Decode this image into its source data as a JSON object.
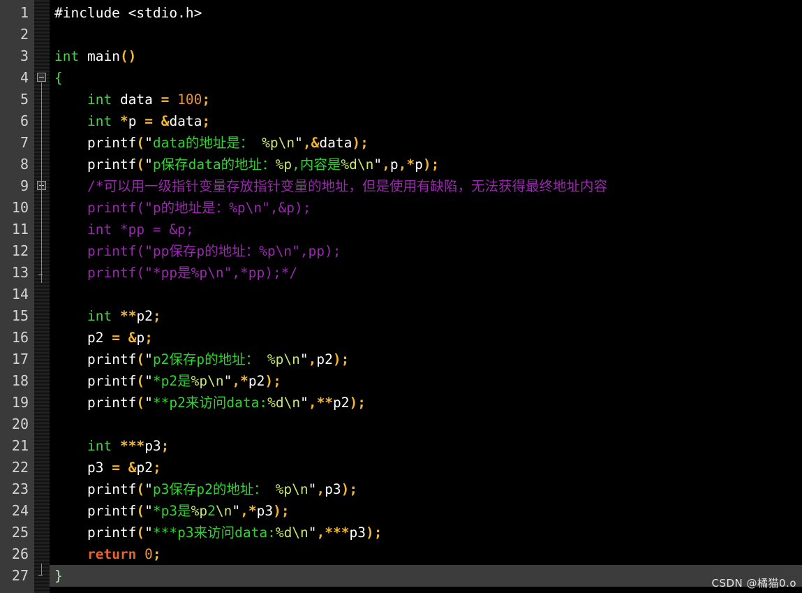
{
  "editor": {
    "theme_name": "dark-c-theme",
    "colors": {
      "background": "#000000",
      "gutter_background": "#3a3a3a",
      "gutter_text": "#d4d4d4",
      "current_line_highlight": "#3c3c3c",
      "keyword": "#44d544",
      "keyword_return": "#e8622c",
      "operator": "#f2b632",
      "number": "#e8913a",
      "string": "#2fd52f",
      "format_specifier": "#c8e86a",
      "comment": "#9c27b0",
      "plain_text": "#ffffff"
    },
    "first_line": 1,
    "last_line": 27,
    "current_line": 27,
    "fold_markers": [
      4,
      9
    ],
    "line_numbers": [
      "1",
      "2",
      "3",
      "4",
      "5",
      "6",
      "7",
      "8",
      "9",
      "10",
      "11",
      "12",
      "13",
      "14",
      "15",
      "16",
      "17",
      "18",
      "19",
      "20",
      "21",
      "22",
      "23",
      "24",
      "25",
      "26",
      "27"
    ],
    "lines": [
      {
        "n": 1,
        "indent": 0,
        "tokens": [
          {
            "t": "#include <stdio.h>",
            "c": "pre"
          }
        ]
      },
      {
        "n": 2,
        "indent": 0,
        "tokens": []
      },
      {
        "n": 3,
        "indent": 0,
        "tokens": [
          {
            "t": "int",
            "c": "kw"
          },
          {
            "t": " main",
            "c": "plain"
          },
          {
            "t": "()",
            "c": "op"
          }
        ]
      },
      {
        "n": 4,
        "indent": 0,
        "tokens": [
          {
            "t": "{",
            "c": "kw"
          }
        ]
      },
      {
        "n": 5,
        "indent": 4,
        "tokens": [
          {
            "t": "int",
            "c": "kw"
          },
          {
            "t": " data ",
            "c": "plain"
          },
          {
            "t": "=",
            "c": "op"
          },
          {
            "t": " ",
            "c": "plain"
          },
          {
            "t": "100",
            "c": "num"
          },
          {
            "t": ";",
            "c": "op"
          }
        ]
      },
      {
        "n": 6,
        "indent": 4,
        "tokens": [
          {
            "t": "int",
            "c": "kw"
          },
          {
            "t": " ",
            "c": "plain"
          },
          {
            "t": "*",
            "c": "op"
          },
          {
            "t": "p ",
            "c": "plain"
          },
          {
            "t": "=",
            "c": "op"
          },
          {
            "t": " ",
            "c": "plain"
          },
          {
            "t": "&",
            "c": "op"
          },
          {
            "t": "data",
            "c": "plain"
          },
          {
            "t": ";",
            "c": "op"
          }
        ]
      },
      {
        "n": 7,
        "indent": 4,
        "tokens": [
          {
            "t": "printf",
            "c": "plain"
          },
          {
            "t": "(",
            "c": "op"
          },
          {
            "t": "\"",
            "c": "quote"
          },
          {
            "t": "data的地址是：",
            "c": "str"
          },
          {
            "t": " %p\\n",
            "c": "fmt"
          },
          {
            "t": "\"",
            "c": "quote"
          },
          {
            "t": ",",
            "c": "op"
          },
          {
            "t": "&",
            "c": "op"
          },
          {
            "t": "data",
            "c": "plain"
          },
          {
            "t": ")",
            "c": "op"
          },
          {
            "t": ";",
            "c": "op"
          }
        ]
      },
      {
        "n": 8,
        "indent": 4,
        "tokens": [
          {
            "t": "printf",
            "c": "plain"
          },
          {
            "t": "(",
            "c": "op"
          },
          {
            "t": "\"",
            "c": "quote"
          },
          {
            "t": "p保存data的地址：",
            "c": "str"
          },
          {
            "t": "%p",
            "c": "fmt"
          },
          {
            "t": ",",
            "c": "str"
          },
          {
            "t": "内容是",
            "c": "str"
          },
          {
            "t": "%d\\n",
            "c": "fmt"
          },
          {
            "t": "\"",
            "c": "quote"
          },
          {
            "t": ",",
            "c": "op"
          },
          {
            "t": "p",
            "c": "plain"
          },
          {
            "t": ",",
            "c": "op"
          },
          {
            "t": "*",
            "c": "op"
          },
          {
            "t": "p",
            "c": "plain"
          },
          {
            "t": ")",
            "c": "op"
          },
          {
            "t": ";",
            "c": "op"
          }
        ]
      },
      {
        "n": 9,
        "indent": 4,
        "tokens": [
          {
            "t": "/*可以用一级指针变量存放指针变量的地址，但是使用有缺陷，无法获得最终地址内容",
            "c": "cmt"
          }
        ]
      },
      {
        "n": 10,
        "indent": 4,
        "tokens": [
          {
            "t": "printf(\"p的地址是：%p\\n\",&p);",
            "c": "cmt"
          }
        ]
      },
      {
        "n": 11,
        "indent": 4,
        "tokens": [
          {
            "t": "int *pp = &p;",
            "c": "cmt"
          }
        ]
      },
      {
        "n": 12,
        "indent": 4,
        "tokens": [
          {
            "t": "printf(\"pp保存p的地址：%p\\n\",pp);",
            "c": "cmt"
          }
        ]
      },
      {
        "n": 13,
        "indent": 4,
        "tokens": [
          {
            "t": "printf(\"*pp是%p\\n\",*pp);*/",
            "c": "cmt"
          }
        ]
      },
      {
        "n": 14,
        "indent": 0,
        "tokens": []
      },
      {
        "n": 15,
        "indent": 4,
        "tokens": [
          {
            "t": "int",
            "c": "kw"
          },
          {
            "t": " ",
            "c": "plain"
          },
          {
            "t": "**",
            "c": "op"
          },
          {
            "t": "p2",
            "c": "plain"
          },
          {
            "t": ";",
            "c": "op"
          }
        ]
      },
      {
        "n": 16,
        "indent": 4,
        "tokens": [
          {
            "t": "p2 ",
            "c": "plain"
          },
          {
            "t": "=",
            "c": "op"
          },
          {
            "t": " ",
            "c": "plain"
          },
          {
            "t": "&",
            "c": "op"
          },
          {
            "t": "p",
            "c": "plain"
          },
          {
            "t": ";",
            "c": "op"
          }
        ]
      },
      {
        "n": 17,
        "indent": 4,
        "tokens": [
          {
            "t": "printf",
            "c": "plain"
          },
          {
            "t": "(",
            "c": "op"
          },
          {
            "t": "\"",
            "c": "quote"
          },
          {
            "t": "p2保存p的地址：",
            "c": "str"
          },
          {
            "t": " %p\\n",
            "c": "fmt"
          },
          {
            "t": "\"",
            "c": "quote"
          },
          {
            "t": ",",
            "c": "op"
          },
          {
            "t": "p2",
            "c": "plain"
          },
          {
            "t": ")",
            "c": "op"
          },
          {
            "t": ";",
            "c": "op"
          }
        ]
      },
      {
        "n": 18,
        "indent": 4,
        "tokens": [
          {
            "t": "printf",
            "c": "plain"
          },
          {
            "t": "(",
            "c": "op"
          },
          {
            "t": "\"",
            "c": "quote"
          },
          {
            "t": "*p2是",
            "c": "str"
          },
          {
            "t": "%p\\n",
            "c": "fmt"
          },
          {
            "t": "\"",
            "c": "quote"
          },
          {
            "t": ",",
            "c": "op"
          },
          {
            "t": "*",
            "c": "op"
          },
          {
            "t": "p2",
            "c": "plain"
          },
          {
            "t": ")",
            "c": "op"
          },
          {
            "t": ";",
            "c": "op"
          }
        ]
      },
      {
        "n": 19,
        "indent": 4,
        "tokens": [
          {
            "t": "printf",
            "c": "plain"
          },
          {
            "t": "(",
            "c": "op"
          },
          {
            "t": "\"",
            "c": "quote"
          },
          {
            "t": "**p2来访问data:",
            "c": "str"
          },
          {
            "t": "%d\\n",
            "c": "fmt"
          },
          {
            "t": "\"",
            "c": "quote"
          },
          {
            "t": ",",
            "c": "op"
          },
          {
            "t": "**",
            "c": "op"
          },
          {
            "t": "p2",
            "c": "plain"
          },
          {
            "t": ")",
            "c": "op"
          },
          {
            "t": ";",
            "c": "op"
          }
        ]
      },
      {
        "n": 20,
        "indent": 0,
        "tokens": []
      },
      {
        "n": 21,
        "indent": 4,
        "tokens": [
          {
            "t": "int",
            "c": "kw"
          },
          {
            "t": " ",
            "c": "plain"
          },
          {
            "t": "***",
            "c": "op"
          },
          {
            "t": "p3",
            "c": "plain"
          },
          {
            "t": ";",
            "c": "op"
          }
        ]
      },
      {
        "n": 22,
        "indent": 4,
        "tokens": [
          {
            "t": "p3 ",
            "c": "plain"
          },
          {
            "t": "=",
            "c": "op"
          },
          {
            "t": " ",
            "c": "plain"
          },
          {
            "t": "&",
            "c": "op"
          },
          {
            "t": "p2",
            "c": "plain"
          },
          {
            "t": ";",
            "c": "op"
          }
        ]
      },
      {
        "n": 23,
        "indent": 4,
        "tokens": [
          {
            "t": "printf",
            "c": "plain"
          },
          {
            "t": "(",
            "c": "op"
          },
          {
            "t": "\"",
            "c": "quote"
          },
          {
            "t": "p3保存p2的地址：",
            "c": "str"
          },
          {
            "t": " %p\\n",
            "c": "fmt"
          },
          {
            "t": "\"",
            "c": "quote"
          },
          {
            "t": ",",
            "c": "op"
          },
          {
            "t": "p3",
            "c": "plain"
          },
          {
            "t": ")",
            "c": "op"
          },
          {
            "t": ";",
            "c": "op"
          }
        ]
      },
      {
        "n": 24,
        "indent": 4,
        "tokens": [
          {
            "t": "printf",
            "c": "plain"
          },
          {
            "t": "(",
            "c": "op"
          },
          {
            "t": "\"",
            "c": "quote"
          },
          {
            "t": "*p3是",
            "c": "str"
          },
          {
            "t": "%p",
            "c": "fmt"
          },
          {
            "t": "2",
            "c": "str"
          },
          {
            "t": "\\n",
            "c": "fmt"
          },
          {
            "t": "\"",
            "c": "quote"
          },
          {
            "t": ",",
            "c": "op"
          },
          {
            "t": "*",
            "c": "op"
          },
          {
            "t": "p3",
            "c": "plain"
          },
          {
            "t": ")",
            "c": "op"
          },
          {
            "t": ";",
            "c": "op"
          }
        ]
      },
      {
        "n": 25,
        "indent": 4,
        "tokens": [
          {
            "t": "printf",
            "c": "plain"
          },
          {
            "t": "(",
            "c": "op"
          },
          {
            "t": "\"",
            "c": "quote"
          },
          {
            "t": "***p3来访问data:",
            "c": "str"
          },
          {
            "t": "%d\\n",
            "c": "fmt"
          },
          {
            "t": "\"",
            "c": "quote"
          },
          {
            "t": ",",
            "c": "op"
          },
          {
            "t": "***",
            "c": "op"
          },
          {
            "t": "p3",
            "c": "plain"
          },
          {
            "t": ")",
            "c": "op"
          },
          {
            "t": ";",
            "c": "op"
          }
        ]
      },
      {
        "n": 26,
        "indent": 4,
        "tokens": [
          {
            "t": "return",
            "c": "kw2"
          },
          {
            "t": " ",
            "c": "plain"
          },
          {
            "t": "0",
            "c": "num"
          },
          {
            "t": ";",
            "c": "op"
          }
        ]
      },
      {
        "n": 27,
        "indent": 0,
        "tokens": [
          {
            "t": "}",
            "c": "brace-last"
          }
        ]
      }
    ]
  },
  "watermark": {
    "text": "CSDN @橘猫0.o"
  }
}
